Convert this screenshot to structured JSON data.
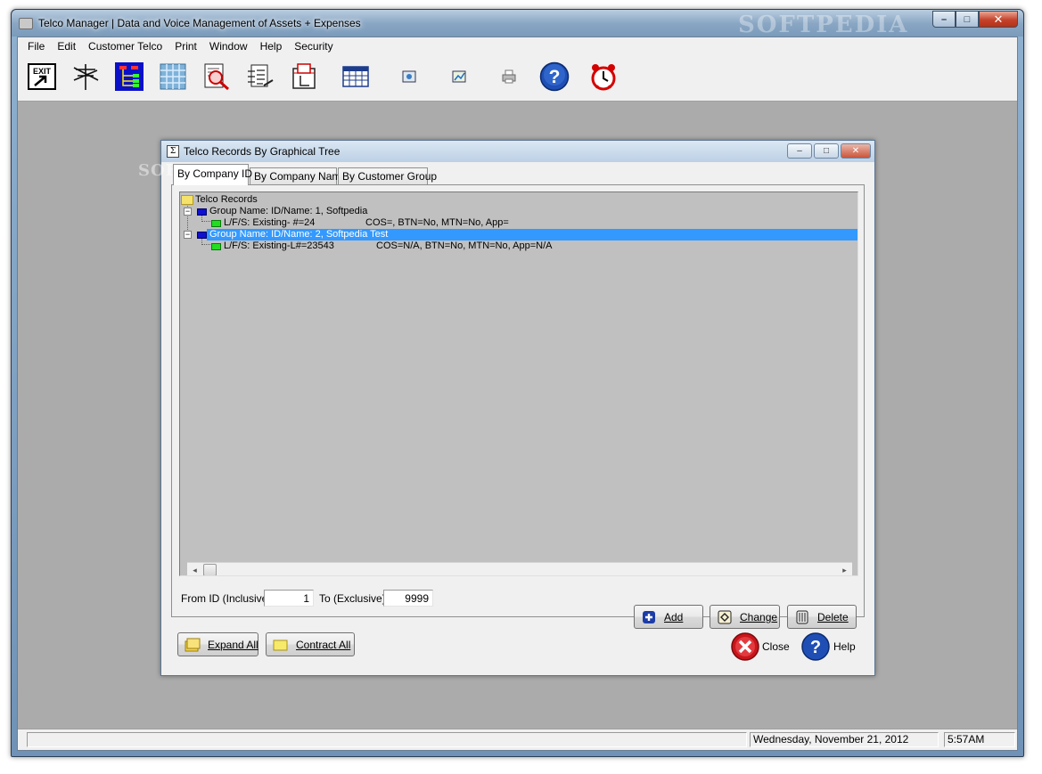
{
  "app": {
    "title": "Telco Manager | Data and Voice Management of Assets + Expenses",
    "watermark": "SOFTPEDIA",
    "caption_buttons": {
      "minimize": "–",
      "maximize": "□",
      "close": "✕"
    }
  },
  "menu": [
    "File",
    "Edit",
    "Customer Telco",
    "Print",
    "Window",
    "Help",
    "Security"
  ],
  "toolbar": {
    "icons": [
      "exit-icon",
      "telephone-pole-icon",
      "network-tree-icon",
      "grid-icon",
      "search-document-icon",
      "report-icon",
      "calendar-page-icon",
      "spreadsheet-icon",
      "small-database-icon",
      "small-chart-icon",
      "printer-icon",
      "help-icon",
      "alarm-clock-icon"
    ],
    "exit_label": "EXIT",
    "help_glyph": "?"
  },
  "dialog": {
    "title": "Telco Records By Graphical Tree",
    "icon_glyph": "Σ",
    "tabs": [
      "By Company ID",
      "By Company Name",
      "By Customer Group"
    ],
    "active_tab": "By Company ID",
    "tree": {
      "root": "Telco Records",
      "groups": [
        {
          "label": "Group Name:  ID/Name: 1, Softpedia",
          "selected": false,
          "child": {
            "label": "L/F/S: Existing- #=24",
            "detail": "COS=, BTN=No, MTN=No, App="
          }
        },
        {
          "label": "Group Name:  ID/Name: 2, Softpedia Test",
          "selected": true,
          "child": {
            "label": "L/F/S: Existing-L#=23543",
            "detail": "COS=N/A, BTN=No, MTN=No, App=N/A"
          }
        }
      ]
    },
    "scroll_left": "◂",
    "scroll_right": "▸",
    "from_id_label": "From ID (Inclusive):",
    "from_id_value": "1",
    "to_label": "To (Exclusive):",
    "to_value": "9999",
    "buttons": {
      "add": "Add",
      "change": "Change",
      "delete": "Delete",
      "expand_all": "Expand All",
      "contract_all": "Contract All",
      "close": "Close",
      "help": "Help"
    },
    "watermark": "SOFTPEDIA"
  },
  "statusbar": {
    "date": "Wednesday, November 21, 2012",
    "time": "5:57AM"
  },
  "colors": {
    "selection": "#3399ff",
    "tree_background": "#c0c0c0",
    "workspace": "#ababab"
  }
}
